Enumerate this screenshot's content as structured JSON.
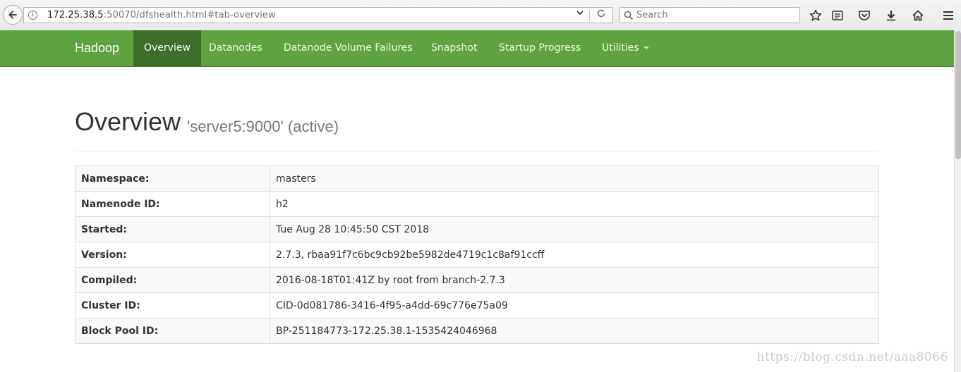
{
  "browser": {
    "url_host": "172.25.38.5",
    "url_rest": ":50070/dfshealth.html#tab-overview",
    "search_placeholder": "Search"
  },
  "navbar": {
    "brand": "Hadoop",
    "items": [
      {
        "label": "Overview",
        "active": true
      },
      {
        "label": "Datanodes"
      },
      {
        "label": "Datanode Volume Failures"
      },
      {
        "label": "Snapshot"
      },
      {
        "label": "Startup Progress"
      },
      {
        "label": "Utilities"
      }
    ]
  },
  "header": {
    "title": "Overview",
    "subtitle": "'server5:9000' (active)"
  },
  "overview_table": [
    {
      "label": "Namespace:",
      "value": "masters"
    },
    {
      "label": "Namenode ID:",
      "value": "h2"
    },
    {
      "label": "Started:",
      "value": "Tue Aug 28 10:45:50 CST 2018"
    },
    {
      "label": "Version:",
      "value": "2.7.3, rbaa91f7c6bc9cb92be5982de4719c1c8af91ccff"
    },
    {
      "label": "Compiled:",
      "value": "2016-08-18T01:41Z by root from branch-2.7.3"
    },
    {
      "label": "Cluster ID:",
      "value": "CID-0d081786-3416-4f95-a4dd-69c776e75a09"
    },
    {
      "label": "Block Pool ID:",
      "value": "BP-251184773-172.25.38.1-1535424046968"
    }
  ],
  "watermark": "https://blog.csdn.net/aaa8066",
  "colors": {
    "navbar_green": "#5fa341",
    "navbar_active": "#3e6f2a"
  }
}
